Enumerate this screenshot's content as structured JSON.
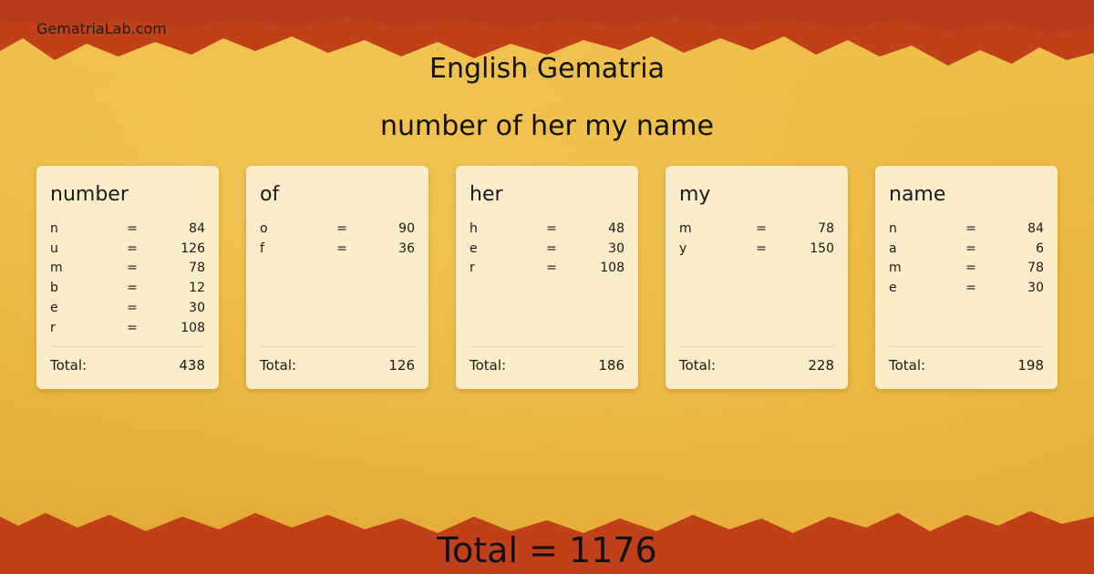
{
  "colors": {
    "background": "#e9b63a",
    "band": "#c0401a",
    "card": "#fbecca"
  },
  "site": {
    "logo": "GematriaLab.com"
  },
  "title": "English Gematria",
  "phrase": "number of her my name",
  "total_label": "Total:",
  "words": [
    {
      "word": "number",
      "letters": [
        {
          "letter": "n",
          "eq": "=",
          "value": "84"
        },
        {
          "letter": "u",
          "eq": "=",
          "value": "126"
        },
        {
          "letter": "m",
          "eq": "=",
          "value": "78"
        },
        {
          "letter": "b",
          "eq": "=",
          "value": "12"
        },
        {
          "letter": "e",
          "eq": "=",
          "value": "30"
        },
        {
          "letter": "r",
          "eq": "=",
          "value": "108"
        }
      ],
      "total": "438"
    },
    {
      "word": "of",
      "letters": [
        {
          "letter": "o",
          "eq": "=",
          "value": "90"
        },
        {
          "letter": "f",
          "eq": "=",
          "value": "36"
        }
      ],
      "total": "126"
    },
    {
      "word": "her",
      "letters": [
        {
          "letter": "h",
          "eq": "=",
          "value": "48"
        },
        {
          "letter": "e",
          "eq": "=",
          "value": "30"
        },
        {
          "letter": "r",
          "eq": "=",
          "value": "108"
        }
      ],
      "total": "186"
    },
    {
      "word": "my",
      "letters": [
        {
          "letter": "m",
          "eq": "=",
          "value": "78"
        },
        {
          "letter": "y",
          "eq": "=",
          "value": "150"
        }
      ],
      "total": "228"
    },
    {
      "word": "name",
      "letters": [
        {
          "letter": "n",
          "eq": "=",
          "value": "84"
        },
        {
          "letter": "a",
          "eq": "=",
          "value": "6"
        },
        {
          "letter": "m",
          "eq": "=",
          "value": "78"
        },
        {
          "letter": "e",
          "eq": "=",
          "value": "30"
        }
      ],
      "total": "198"
    }
  ],
  "grand_total": "Total = 1176"
}
